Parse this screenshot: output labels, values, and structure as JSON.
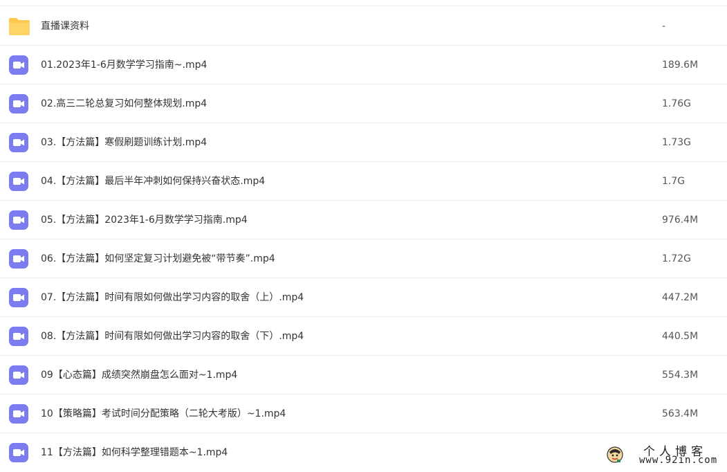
{
  "files": [
    {
      "type": "folder",
      "icon": "folder-icon",
      "name": "直播课资料",
      "size": "-"
    },
    {
      "type": "video",
      "icon": "video-file-icon",
      "name": "01.2023年1-6月数学学习指南~.mp4",
      "size": "189.6M"
    },
    {
      "type": "video",
      "icon": "video-file-icon",
      "name": "02.高三二轮总复习如何整体规划.mp4",
      "size": "1.76G"
    },
    {
      "type": "video",
      "icon": "video-file-icon",
      "name": "03.【方法篇】寒假刷题训练计划.mp4",
      "size": "1.73G"
    },
    {
      "type": "video",
      "icon": "video-file-icon",
      "name": "04.【方法篇】最后半年冲刺如何保持兴奋状态.mp4",
      "size": "1.7G"
    },
    {
      "type": "video",
      "icon": "video-file-icon",
      "name": "05.【方法篇】2023年1-6月数学学习指南.mp4",
      "size": "976.4M"
    },
    {
      "type": "video",
      "icon": "video-file-icon",
      "name": "06.【方法篇】如何坚定复习计划避免被“带节奏”.mp4",
      "size": "1.72G"
    },
    {
      "type": "video",
      "icon": "video-file-icon",
      "name": "07.【方法篇】时间有限如何做出学习内容的取舍（上）.mp4",
      "size": "447.2M"
    },
    {
      "type": "video",
      "icon": "video-file-icon",
      "name": "08.【方法篇】时间有限如何做出学习内容的取舍（下）.mp4",
      "size": "440.5M"
    },
    {
      "type": "video",
      "icon": "video-file-icon",
      "name": "09【心态篇】成绩突然崩盘怎么面对~1.mp4",
      "size": "554.3M"
    },
    {
      "type": "video",
      "icon": "video-file-icon",
      "name": "10【策略篇】考试时间分配策略（二轮大考版）~1.mp4",
      "size": "563.4M"
    },
    {
      "type": "video",
      "icon": "video-file-icon",
      "name": "11【方法篇】如何科学整理错题本~1.mp4",
      "size": ""
    }
  ],
  "watermark": {
    "title": "个人博客",
    "url": "www.92in.com"
  },
  "colors": {
    "folder": "#FFC94D",
    "video_icon": "#7A7CF0",
    "divider": "#ECECEC"
  }
}
